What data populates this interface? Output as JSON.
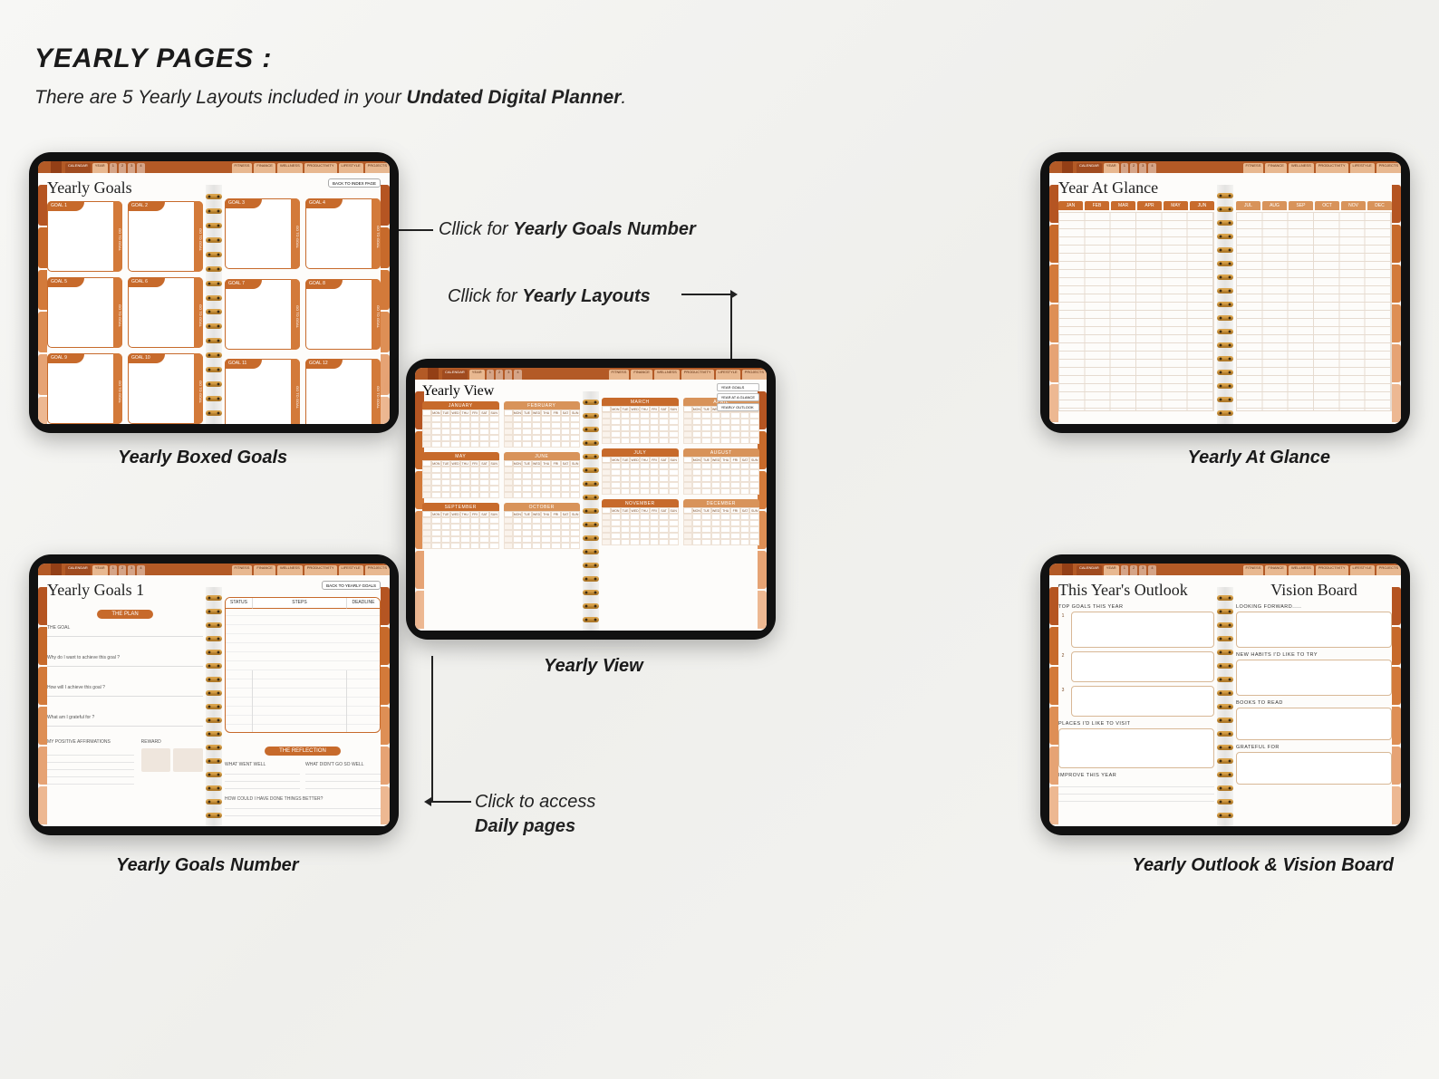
{
  "title": "YEARLY PAGES :",
  "subtitle_pre": "There are 5 Yearly Layouts included in your ",
  "subtitle_bold": "Undated Digital Planner",
  "subtitle_post": ".",
  "annotations": {
    "goals_number": {
      "pre": "Cllick for ",
      "bold": "Yearly Goals Number"
    },
    "yearly_layouts": {
      "pre": "Cllick for ",
      "bold": "Yearly Layouts"
    },
    "daily": {
      "line1": "Click to access ",
      "line2": "Daily pages"
    }
  },
  "captions": {
    "boxed": "Yearly Boxed Goals",
    "number": "Yearly Goals Number",
    "view": "Yearly View",
    "glance": "Yearly At Glance",
    "outlook": "Yearly Outlook & Vision Board"
  },
  "top_tabs_left": [
    "CALENDAR",
    "YEAR",
    "1",
    "2",
    "3",
    "4"
  ],
  "top_tabs_right": [
    "FITNESS",
    "FINANCE",
    "WELLNESS",
    "PRODUCTIVITY",
    "LIFESTYLE",
    "PROJECTS"
  ],
  "goal_labels": [
    "GOAL 1",
    "GOAL 2",
    "GOAL 3",
    "GOAL 4",
    "GOAL 5",
    "GOAL 6",
    "GOAL 7",
    "GOAL 8",
    "GOAL 9",
    "GOAL 10",
    "GOAL 11",
    "GOAL 12"
  ],
  "go_to_goal": "GO TO GOAL",
  "back_index": "BACK TO INDEX PAGE",
  "back_goals": "BACK TO YEARLY GOALS",
  "yearly_goals_title": "Yearly Goals",
  "yearly_goals1_title": "Yearly Goals 1",
  "yearly_view_title": "Yearly View",
  "year_glance_title": "Year At Glance",
  "outlook_title": "This Year's Outlook",
  "vision_title": "Vision Board",
  "plan_pill": "THE PLAN",
  "reflection_pill": "THE REFLECTION",
  "plan_fields": {
    "goal": "THE GOAL",
    "why": "Why do I want to achieve this goal ?",
    "how": "How will I achieve this goal ?",
    "grateful": "What am I grateful for ?",
    "affirm": "MY POSITIVE AFFIRMATIONS",
    "reward": "REWARD"
  },
  "steps_headers": [
    "STATUS",
    "STEPS",
    "DEADLINE"
  ],
  "reflection_fields": {
    "well": "WHAT WENT WELL",
    "notwell": "WHAT DIDN'T GO SO WELL",
    "better": "HOW COULD I HAVE DONE THINGS BETTER?"
  },
  "months": [
    "JANUARY",
    "FEBRUARY",
    "MARCH",
    "APRIL",
    "MAY",
    "JUNE",
    "JULY",
    "AUGUST",
    "SEPTEMBER",
    "OCTOBER",
    "NOVEMBER",
    "DECEMBER"
  ],
  "months_short": [
    "JAN",
    "FEB",
    "MAR",
    "APR",
    "MAY",
    "JUN",
    "JUL",
    "AUG",
    "SEP",
    "OCT",
    "NOV",
    "DEC"
  ],
  "days": [
    "MON",
    "TUE",
    "WED",
    "THU",
    "FRI",
    "SAT",
    "SUN"
  ],
  "view_nav": [
    "YEAR GOALS",
    "YEAR AT A GLANCE",
    "YEARLY OUTLOOK"
  ],
  "outlook": {
    "top_goals": "TOP GOALS THIS YEAR",
    "places": "PLACES I'D LIKE TO VISIT",
    "improve": "IMPROVE THIS YEAR",
    "looking": "LOOKING FORWARD.....",
    "habits": "NEW HABITS I'D LIKE TO TRY",
    "books": "BOOKS TO READ",
    "grateful": "GRATEFUL FOR"
  }
}
